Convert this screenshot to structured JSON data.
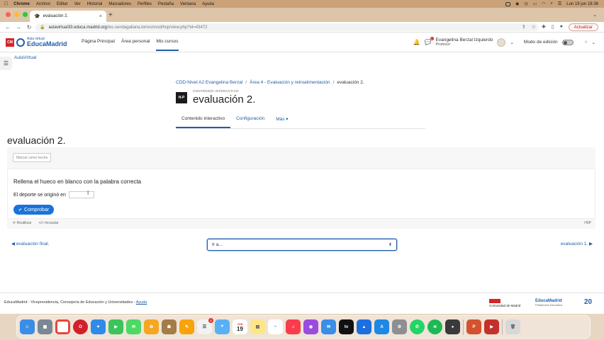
{
  "menubar": {
    "apple": "",
    "items": [
      "Chrome",
      "Archivo",
      "Editar",
      "Ver",
      "Historial",
      "Marcadores",
      "Perfiles",
      "Pestaña",
      "Ventana",
      "Ayuda"
    ],
    "clock": "Lun 19 jun 18:36"
  },
  "browser": {
    "tab_title": "evaluación 2.",
    "url_host": "aulavirtual33.educa.madrid.org",
    "url_path": "/ies.sendagaliana.torres/mod/hvp/view.php?id=43472",
    "update_label": "Actualizar"
  },
  "header": {
    "logo_small": "Aula virtual",
    "logo_big": "EducaMadrid",
    "nav": [
      "Página Principal",
      "Área personal",
      "Mis cursos"
    ],
    "user_name": "Evangelina Berzal Izquierdo",
    "user_role": "Profesor",
    "edit_mode_label": "Modo de edición",
    "chat_badge": "1"
  },
  "side": {
    "link": "AulaVirtual"
  },
  "breadcrumb": {
    "items": [
      "CDD-Nivel A2 Evangelina Berzal",
      "Área 4 - Evaluación y retroalimentación",
      "evaluación 2."
    ]
  },
  "activity": {
    "kind": "CONTENIDO INTERACTIVO",
    "title": "evaluación 2.",
    "hp_icon": "H-P",
    "tabs": [
      "Contenido interactivo",
      "Configuración",
      "Más ▾"
    ]
  },
  "h5p": {
    "title": "evaluación 2.",
    "mark_done": "Marcar como hecha",
    "question": "Rellena el hueco en blanco con la palabra correcta",
    "sentence": "El deporte se originó en",
    "blank_value": "",
    "check_label": "Comprobar",
    "footer_reuse": "Reutilizar",
    "footer_embed": "Incrustar",
    "footer_logo": "H5P"
  },
  "navigation": {
    "prev": "evaluación final.",
    "jump_placeholder": "Ir a...",
    "next": "evaluación 1."
  },
  "footer": {
    "text": "EducaMadrid - Vicepresidencia, Consejería de Educación y Universidades - ",
    "help_link": "Ayuda",
    "logo1": "Comunidad de Madrid",
    "logo2": "EducaMadrid",
    "logo2_sub": "Plataforma Educativa",
    "logo3": "20"
  },
  "dock": {
    "calendar_month": "JUN",
    "calendar_day": "19",
    "reminders_badge": "2"
  }
}
